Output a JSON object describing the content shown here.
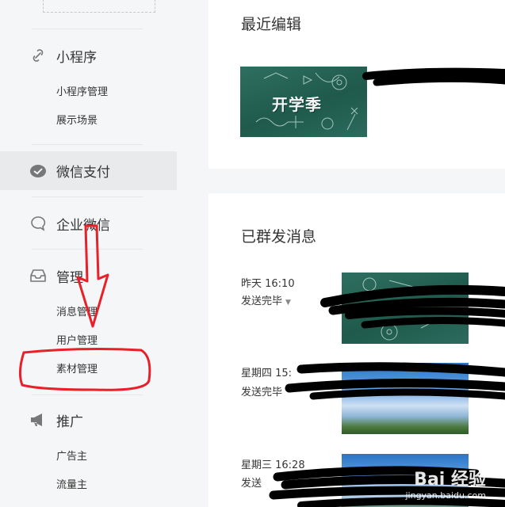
{
  "sidebar": {
    "groups": [
      {
        "label": "小程序",
        "icon": "link-icon",
        "items": [
          "小程序管理",
          "展示场景"
        ]
      },
      {
        "label": "微信支付",
        "icon": "wechat-pay-icon",
        "items": []
      },
      {
        "label": "企业微信",
        "icon": "chat-bubble-icon",
        "items": []
      },
      {
        "label": "管理",
        "icon": "inbox-icon",
        "items": [
          "消息管理",
          "用户管理",
          "素材管理"
        ]
      },
      {
        "label": "推广",
        "icon": "megaphone-icon",
        "items": [
          "广告主",
          "流量主"
        ]
      }
    ]
  },
  "recent": {
    "title": "最近编辑",
    "thumb_text": "开学季"
  },
  "sent": {
    "title": "已群发消息",
    "messages": [
      {
        "time": "昨天 16:10",
        "status": "发送完毕"
      },
      {
        "time": "星期四 15:",
        "status": "发送完毕"
      },
      {
        "time": "星期三 16:28",
        "status": "发送"
      }
    ]
  },
  "watermark": {
    "main": "Bai 经验",
    "sub": "jingyan.baidu.com"
  },
  "colors": {
    "annotation": "#e8202a",
    "active_bg": "#e8eaec",
    "sidebar_bg": "#f5f6f7"
  }
}
